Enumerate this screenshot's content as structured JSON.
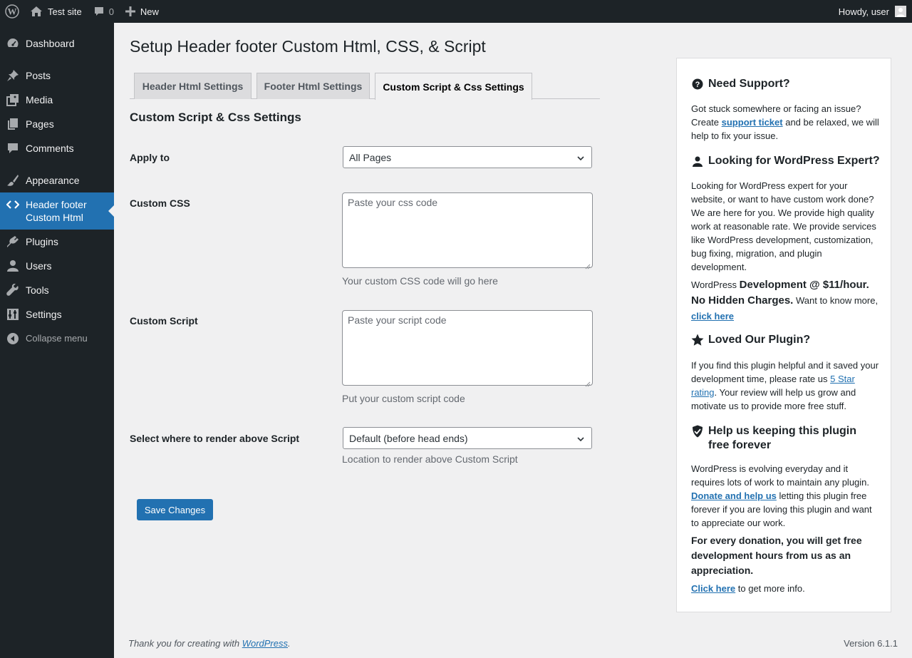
{
  "adminbar": {
    "site_name": "Test site",
    "comments_count": "0",
    "new_label": "New",
    "howdy": "Howdy, user"
  },
  "sidebar": {
    "items": [
      {
        "label": "Dashboard",
        "icon": "dashboard-icon"
      },
      {
        "label": "Posts",
        "icon": "pin-icon"
      },
      {
        "label": "Media",
        "icon": "media-icon"
      },
      {
        "label": "Pages",
        "icon": "pages-icon"
      },
      {
        "label": "Comments",
        "icon": "comment-icon"
      },
      {
        "label": "Appearance",
        "icon": "brush-icon"
      },
      {
        "label": "Header footer Custom Html",
        "icon": "code-icon"
      },
      {
        "label": "Plugins",
        "icon": "plugin-icon"
      },
      {
        "label": "Users",
        "icon": "user-icon"
      },
      {
        "label": "Tools",
        "icon": "wrench-icon"
      },
      {
        "label": "Settings",
        "icon": "settings-icon"
      }
    ],
    "active_item": "Header footer Custom Html",
    "collapse_label": "Collapse menu"
  },
  "main": {
    "page_title": "Setup Header footer Custom Html, CSS, & Script",
    "tabs": [
      {
        "label": "Header Html Settings"
      },
      {
        "label": "Footer Html Settings"
      },
      {
        "label": "Custom Script & Css Settings"
      }
    ],
    "active_tab": "Custom Script & Css Settings",
    "section_title": "Custom Script & Css Settings",
    "apply_to": {
      "label": "Apply to",
      "value": "All Pages"
    },
    "custom_css": {
      "label": "Custom CSS",
      "placeholder": "Paste your css code",
      "description": "Your custom CSS code will go here"
    },
    "custom_script": {
      "label": "Custom Script",
      "placeholder": "Paste your script code",
      "description": "Put your custom script code"
    },
    "render_location": {
      "label": "Select where to render above Script",
      "value": "Default (before head ends)",
      "description": "Location to render above Custom Script"
    },
    "save_label": "Save Changes"
  },
  "support": {
    "need_support": {
      "title": "Need Support?",
      "text_before": "Got stuck somewhere or facing an issue? Create ",
      "link": "support ticket",
      "text_after": " and be relaxed, we will help to fix your issue."
    },
    "expert": {
      "title": "Looking for WordPress Expert?",
      "text": "Looking for WordPress expert for your website, or want to have custom work done? We are here for you. We provide high quality work at reasonable rate. We provide services like WordPress development, customization, bug fixing, migration, and plugin development.",
      "price_prefix": "WordPress ",
      "price_bold": "Development @ $11/hour. No Hidden Charges.",
      "price_suffix": " Want to know more, ",
      "price_link": "click here"
    },
    "loved": {
      "title": "Loved Our Plugin?",
      "text_before": "If you find this plugin helpful and it saved your development time, please rate us ",
      "link": "5 Star rating",
      "text_after": ". Your review will help us grow and motivate us to provide more free stuff."
    },
    "free": {
      "title": "Help us keeping this plugin free forever",
      "text_before": "WordPress is evolving everyday and it requires lots of work to maintain any plugin. ",
      "link": "Donate and help us",
      "text_after": " letting this plugin free forever if you are loving this plugin and want to appreciate our work.",
      "bold": "For every donation, you will get free development hours from us as an appreciation.",
      "click_link": "Click here",
      "click_after": " to get more info."
    }
  },
  "footer": {
    "thanks_prefix": "Thank you for creating with ",
    "thanks_link": "WordPress",
    "thanks_suffix": ".",
    "version": "Version 6.1.1"
  },
  "colors": {
    "accent": "#2271b1",
    "sidebar_bg": "#1d2327",
    "page_bg": "#f0f0f1"
  }
}
